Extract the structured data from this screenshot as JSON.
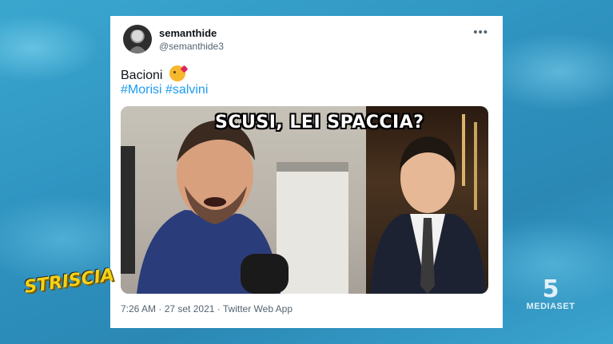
{
  "tweet": {
    "display_name": "semanthide",
    "handle": "@semanthide3",
    "more_icon": "more-horizontal-icon",
    "text": "Bacioni",
    "emoji": "face-blowing-kiss-emoji",
    "hashtags": [
      "#Morisi",
      "#salvini"
    ],
    "media": {
      "caption": "SCUSI, LEI SPACCIA?"
    },
    "timestamp": "7:26 AM · 27 set 2021 · Twitter Web App"
  },
  "overlay": {
    "show_logo": "STRISCIA",
    "channel_logo_number": "5",
    "channel_logo_text": "MEDIASET"
  },
  "colors": {
    "background": "#2f93c0",
    "hashtag": "#1d9bf0",
    "logo_yellow": "#f3d21a"
  }
}
